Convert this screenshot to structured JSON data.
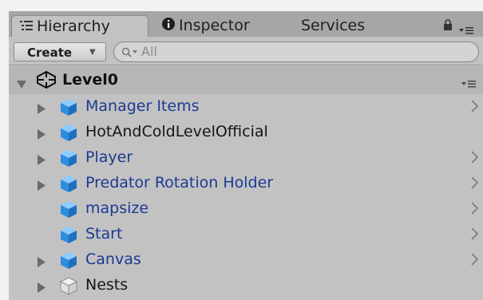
{
  "tabs": {
    "hierarchy": "Hierarchy",
    "inspector": "Inspector",
    "services": "Services"
  },
  "toolbar": {
    "create_label": "Create",
    "search_placeholder": "All"
  },
  "scene": {
    "name": "Level0"
  },
  "tree_items": [
    {
      "label": "Manager Items",
      "prefab": true,
      "expandable": true,
      "chevron": true
    },
    {
      "label": "HotAndColdLevelOfficial",
      "prefab": false,
      "expandable": true,
      "chevron": false
    },
    {
      "label": "Player",
      "prefab": true,
      "expandable": true,
      "chevron": true
    },
    {
      "label": "Predator Rotation Holder",
      "prefab": true,
      "expandable": true,
      "chevron": true
    },
    {
      "label": "mapsize",
      "prefab": true,
      "expandable": false,
      "chevron": true
    },
    {
      "label": "Start",
      "prefab": true,
      "expandable": false,
      "chevron": true
    },
    {
      "label": "Canvas",
      "prefab": true,
      "expandable": true,
      "chevron": true
    },
    {
      "label": "Nests",
      "prefab": false,
      "expandable": true,
      "chevron": false,
      "empty_object": true
    }
  ],
  "colors": {
    "prefab_text": "#1b3a92",
    "plain_text": "#151515",
    "cube_blue": "#2f8de0",
    "panel_bg": "#c2c2c2"
  }
}
